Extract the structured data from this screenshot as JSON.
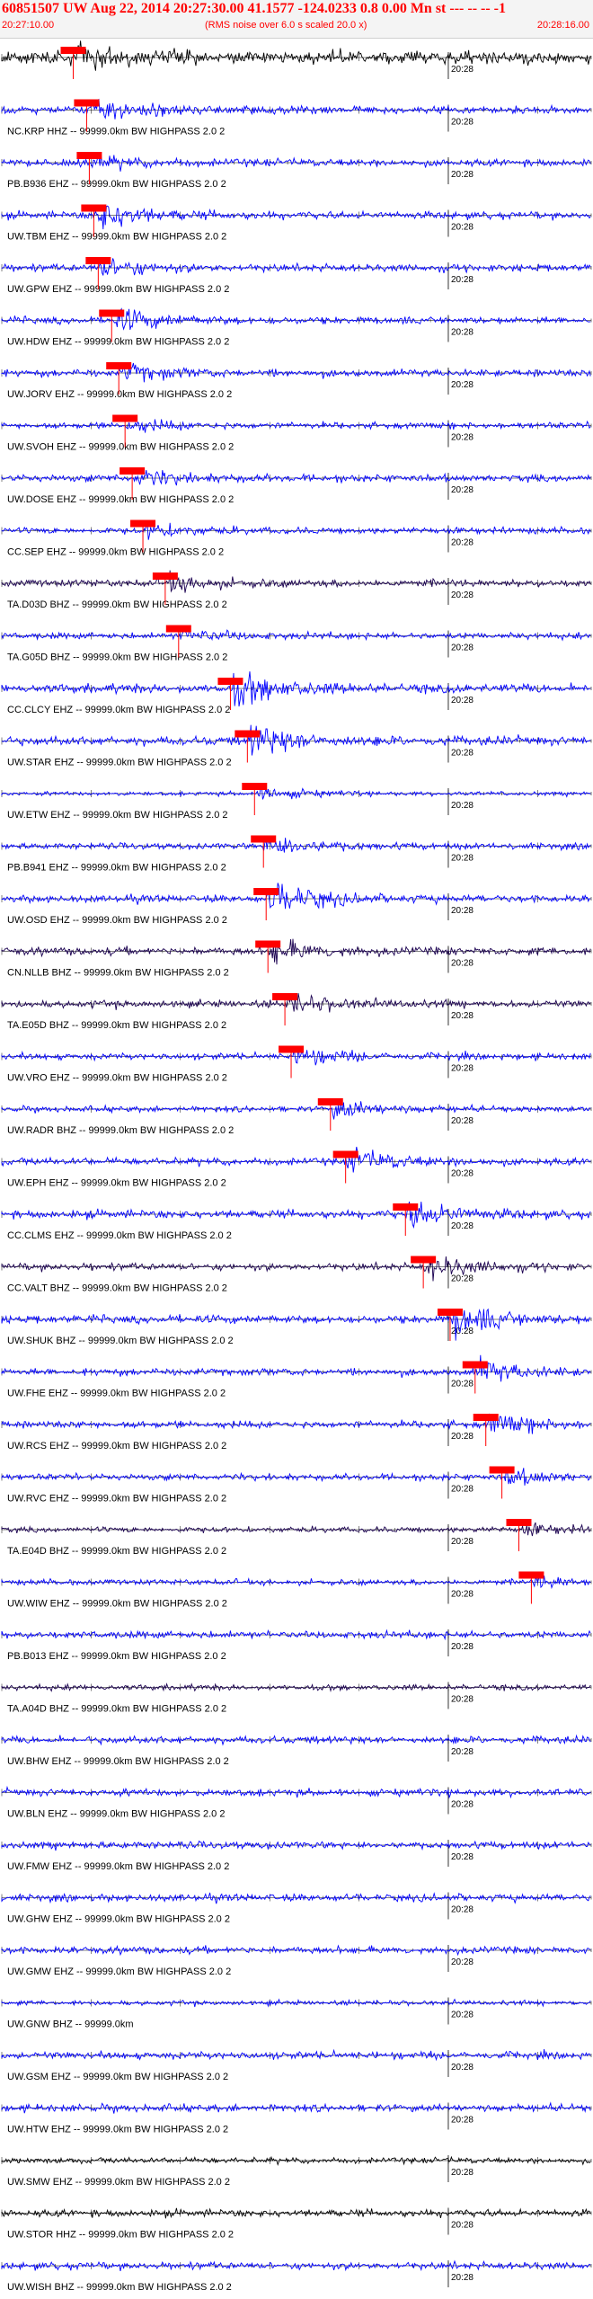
{
  "header": {
    "title": "60851507 UW Aug 22, 2014 20:27:30.00   41.1577 -124.0233  0.8 0.00 Mn st --- -- --  -1",
    "start_time": "20:27:10.00",
    "end_time": "20:28:16.00",
    "rms_note": "(RMS noise over 6.0 s scaled 20.0 x)"
  },
  "colors": {
    "header_text": "#ff0000",
    "trace_blue": "#0000ff",
    "trace_dark": "#1a0050",
    "trace_black": "#000000",
    "pick": "#ff0000",
    "grid": "#000000"
  },
  "chart_data": {
    "type": "line",
    "description_text": "",
    "x_unit": "time",
    "x_start": "20:27:10.00",
    "x_end": "20:28:16.00",
    "minute_tick_label": "20:28",
    "minute_tick_time": "20:28:00",
    "trace_suffix": "-- 99999.0km BW  HIGHPASS  2.0  2",
    "series": [
      {
        "name": "",
        "label": "",
        "color": "black",
        "p": 8.0,
        "amp": 0.8,
        "event": 0.6
      },
      {
        "name": "NC.KRP HHZ",
        "color": "blue",
        "p": 9.5,
        "amp": 0.5,
        "event": 0.55
      },
      {
        "name": "PB.B936 EHZ",
        "color": "blue",
        "p": 9.8,
        "amp": 0.45,
        "event": 0.3
      },
      {
        "name": "UW.TBM EHZ",
        "color": "blue",
        "p": 10.3,
        "amp": 0.45,
        "event": 0.85
      },
      {
        "name": "UW.GPW EHZ",
        "color": "blue",
        "p": 10.8,
        "amp": 0.45,
        "event": 0.5
      },
      {
        "name": "UW.HDW EHZ",
        "color": "blue",
        "p": 12.3,
        "amp": 0.45,
        "event": 0.6
      },
      {
        "name": "UW.JORV EHZ",
        "color": "blue",
        "p": 13.1,
        "amp": 0.45,
        "event": 0.45
      },
      {
        "name": "UW.SVOH EHZ",
        "color": "blue",
        "p": 13.8,
        "amp": 0.4,
        "event": 0.3
      },
      {
        "name": "UW.DOSE EHZ",
        "color": "blue",
        "p": 14.6,
        "amp": 0.45,
        "event": 0.45
      },
      {
        "name": "CC.SEP EHZ",
        "color": "blue",
        "p": 15.8,
        "amp": 0.4,
        "event": 0.35
      },
      {
        "name": "TA.D03D BHZ",
        "color": "dark",
        "p": 18.3,
        "amp": 0.45,
        "event": 0.4
      },
      {
        "name": "TA.G05D BHZ",
        "color": "blue",
        "p": 19.8,
        "amp": 0.4,
        "event": 0.35
      },
      {
        "name": "CC.CLCY EHZ",
        "color": "blue",
        "p": 25.6,
        "amp": 0.55,
        "event": 0.95
      },
      {
        "name": "UW.STAR EHZ",
        "color": "blue",
        "p": 27.5,
        "amp": 0.55,
        "event": 0.9
      },
      {
        "name": "UW.ETW EHZ",
        "color": "blue",
        "p": 28.3,
        "amp": 0.25,
        "event": 0.4
      },
      {
        "name": "PB.B941 EHZ",
        "color": "blue",
        "p": 29.3,
        "amp": 0.4,
        "event": 0.65
      },
      {
        "name": "UW.OSD EHZ",
        "color": "blue",
        "p": 29.6,
        "amp": 0.45,
        "event": 0.95
      },
      {
        "name": "CN.NLLB BHZ",
        "color": "dark",
        "p": 29.8,
        "amp": 0.5,
        "event": 0.6
      },
      {
        "name": "TA.E05D BHZ",
        "color": "dark",
        "p": 31.7,
        "amp": 0.45,
        "event": 0.5
      },
      {
        "name": "UW.VRO EHZ",
        "color": "blue",
        "p": 32.4,
        "amp": 0.4,
        "event": 0.5
      },
      {
        "name": "UW.RADR BHZ",
        "color": "blue",
        "p": 36.8,
        "amp": 0.35,
        "event": 0.5
      },
      {
        "name": "UW.EPH EHZ",
        "color": "blue",
        "p": 38.5,
        "amp": 0.45,
        "event": 0.65
      },
      {
        "name": "CC.CLMS EHZ",
        "color": "blue",
        "p": 45.2,
        "amp": 0.5,
        "event": 0.7
      },
      {
        "name": "CC.VALT BHZ",
        "color": "dark",
        "p": 47.2,
        "amp": 0.45,
        "event": 0.6
      },
      {
        "name": "UW.SHUK BHZ",
        "color": "blue",
        "p": 50.2,
        "amp": 0.5,
        "event": 0.85
      },
      {
        "name": "UW.FHE EHZ",
        "color": "blue",
        "p": 53.0,
        "amp": 0.45,
        "event": 0.6
      },
      {
        "name": "UW.RCS EHZ",
        "color": "blue",
        "p": 54.2,
        "amp": 0.45,
        "event": 0.6
      },
      {
        "name": "UW.RVC EHZ",
        "color": "blue",
        "p": 56.0,
        "amp": 0.4,
        "event": 0.45
      },
      {
        "name": "TA.E04D BHZ",
        "color": "dark",
        "p": 57.9,
        "amp": 0.35,
        "event": 0.3
      },
      {
        "name": "UW.WIW EHZ",
        "color": "blue",
        "p": 59.3,
        "amp": 0.35,
        "event": 0.3
      },
      {
        "name": "PB.B013 EHZ",
        "color": "blue",
        "p": 0,
        "amp": 0.45,
        "event": 0
      },
      {
        "name": "TA.A04D BHZ",
        "color": "dark",
        "p": 0,
        "amp": 0.35,
        "event": 0
      },
      {
        "name": "UW.BHW EHZ",
        "color": "blue",
        "p": 0,
        "amp": 0.45,
        "event": 0
      },
      {
        "name": "UW.BLN EHZ",
        "color": "blue",
        "p": 0,
        "amp": 0.45,
        "event": 0
      },
      {
        "name": "UW.FMW EHZ",
        "color": "blue",
        "p": 0,
        "amp": 0.45,
        "event": 0
      },
      {
        "name": "UW.GHW EHZ",
        "color": "blue",
        "p": 0,
        "amp": 0.45,
        "event": 0
      },
      {
        "name": "UW.GMW EHZ",
        "color": "blue",
        "p": 0,
        "amp": 0.45,
        "event": 0
      },
      {
        "name": "UW.GNW BHZ",
        "color": "blue",
        "p": 0,
        "amp": 0.3,
        "event": 0,
        "label": "UW.GNW BHZ -- 99999.0km"
      },
      {
        "name": "UW.GSM EHZ",
        "color": "blue",
        "p": 0,
        "amp": 0.45,
        "event": 0
      },
      {
        "name": "UW.HTW EHZ",
        "color": "blue",
        "p": 0,
        "amp": 0.45,
        "event": 0
      },
      {
        "name": "UW.SMW EHZ",
        "color": "black",
        "p": 0,
        "amp": 0.35,
        "event": 0
      },
      {
        "name": "UW.STOR HHZ",
        "color": "black",
        "p": 0,
        "amp": 0.45,
        "event": 0
      },
      {
        "name": "UW.WISH BHZ",
        "color": "blue",
        "p": 0,
        "amp": 0.45,
        "event": 0
      }
    ]
  }
}
